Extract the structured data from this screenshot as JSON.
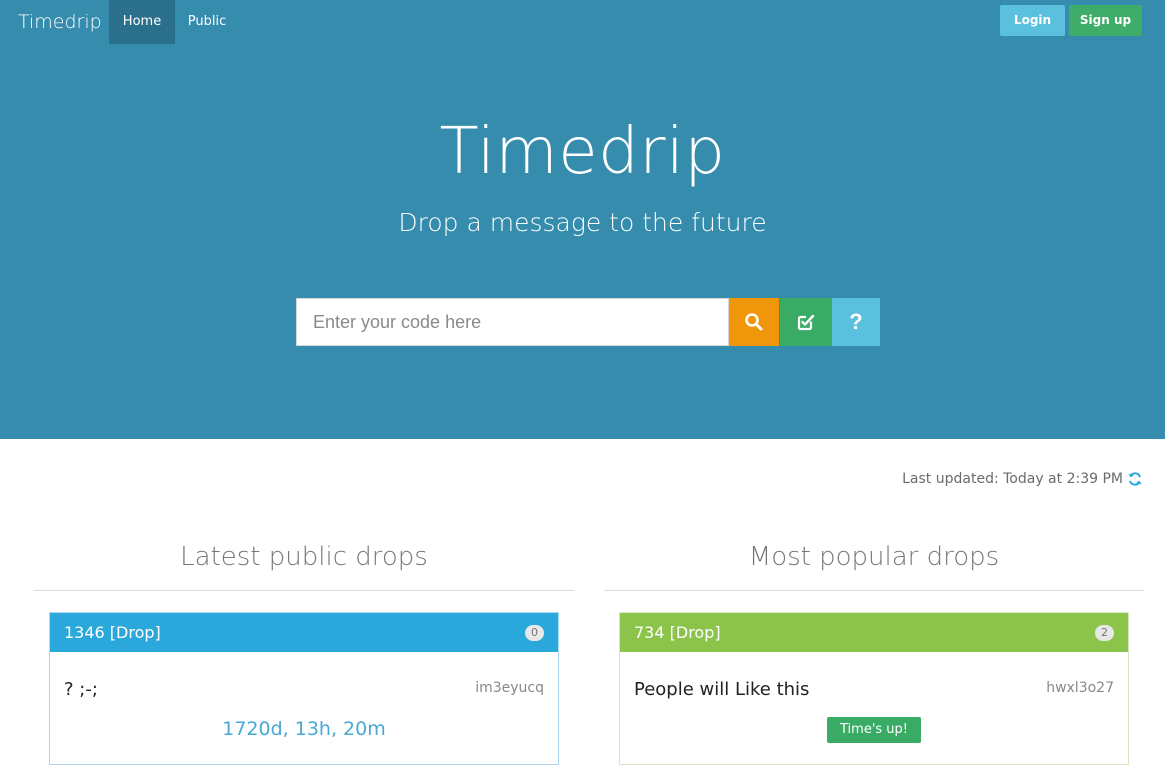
{
  "nav": {
    "brand": "Timedrip",
    "links": [
      {
        "label": "Home"
      },
      {
        "label": "Public"
      }
    ],
    "login_label": "Login",
    "signup_label": "Sign up"
  },
  "hero": {
    "title": "Timedrip",
    "subtitle": "Drop a message to the future",
    "search_placeholder": "Enter your code here",
    "search_icon": "search-icon",
    "create_icon": "edit-check-icon",
    "help_label": "?"
  },
  "status": {
    "last_updated": "Last updated: Today at 2:39 PM",
    "refresh_icon": "refresh-icon"
  },
  "sections": {
    "latest": {
      "title": "Latest public drops",
      "drops": [
        {
          "header": "1346 [Drop]",
          "badge": "0",
          "message": "? ;-;",
          "code": "im3eyucq",
          "countdown": "1720d, 13h, 20m"
        }
      ]
    },
    "popular": {
      "title": "Most popular drops",
      "drops": [
        {
          "header": "734 [Drop]",
          "badge": "2",
          "message": "People will Like this",
          "code": "hwxl3o27",
          "status_label": "Time's up!"
        }
      ]
    }
  },
  "colors": {
    "hero_bg": "#358cad",
    "nav_active": "#2a6f8c",
    "search_btn": "#f0960b",
    "create_btn": "#3aab65",
    "help_btn": "#5bc0de",
    "latest_header": "#2aa8dc",
    "popular_header": "#8cc34a"
  }
}
